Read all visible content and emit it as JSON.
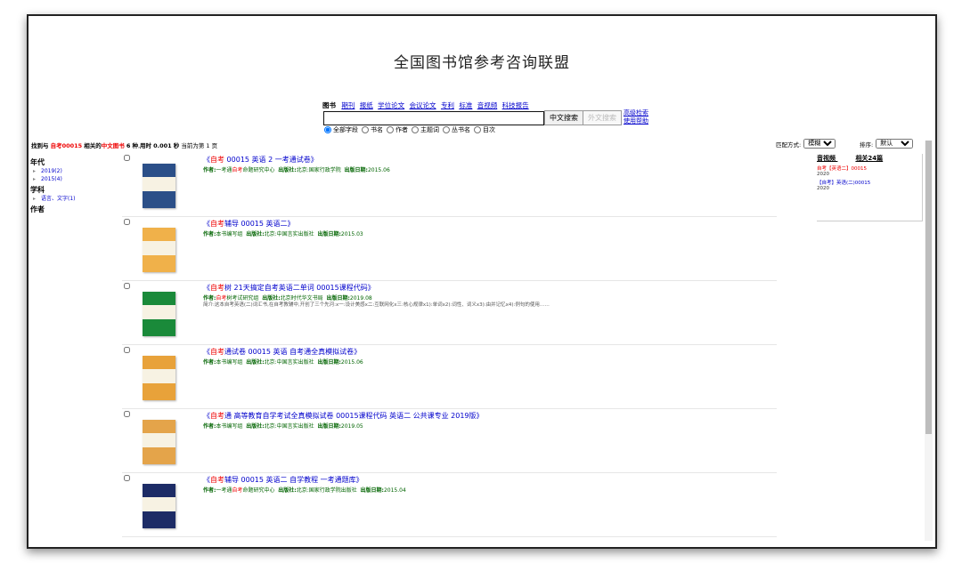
{
  "site": {
    "title": "全国图书馆参考咨询联盟"
  },
  "nav": {
    "current": "图书",
    "links": [
      "期刊",
      "报纸",
      "学位论文",
      "会议论文",
      "专利",
      "标准",
      "音视频",
      "科技报告"
    ]
  },
  "search": {
    "value": "",
    "cn_button": "中文搜索",
    "en_button": "外文搜索",
    "advanced": "高级检索",
    "help": "使用帮助",
    "fields": [
      "全部字段",
      "书名",
      "作者",
      "主题词",
      "丛书名",
      "目次"
    ],
    "selected_field": "全部字段"
  },
  "status": {
    "found_prefix": "找到与",
    "query": "自考00015",
    "related": "相关的",
    "collection": "中文图书",
    "count": "6",
    "unit": "种",
    "time_label": "用时",
    "time_value": "0.001",
    "time_unit": "秒",
    "page_text": "当前为第 1 页"
  },
  "match": {
    "label": "匹配方式:",
    "value": "模糊"
  },
  "sort": {
    "label": "排序:",
    "value": "默认"
  },
  "facets": {
    "year_title": "年代",
    "years": [
      "2019(2)",
      "2015(4)"
    ],
    "subject_title": "学科",
    "subjects": [
      "语言、文字(1)"
    ],
    "author_title": "作者"
  },
  "results": [
    {
      "title_parts": [
        "《",
        "自考",
        " 00015 英语 2 一考通试卷",
        "》"
      ],
      "author_prefix": "一考通",
      "author_hl": "自考",
      "author_suffix": "命题研究中心",
      "publisher": "北京:国家行政学院",
      "date": "2015.06",
      "snippet": ""
    },
    {
      "title_parts": [
        "《",
        "自考",
        "辅导 00015 英语二",
        "》"
      ],
      "author_prefix": "本书编写组",
      "author_hl": "",
      "author_suffix": "",
      "publisher": "北京:中国言实出版社",
      "date": "2015.03",
      "snippet": ""
    },
    {
      "title_parts": [
        "《",
        "自考",
        "树 21天搞定自考英语二单词 00015课程代码",
        "》"
      ],
      "author_prefix": "",
      "author_hl": "自考",
      "author_suffix": "树考试研究组",
      "publisher": "北京时代华文书局",
      "date": "2019.08",
      "snippet": "简介:这本自考英语(二)词汇书,在自考教辅中,开创了三个先河:x一:设计美感x二:互联网化x三:核心规律x1):单词x2):词性、词义x3):由并记忆x4):例句的使用……"
    },
    {
      "title_parts": [
        "《",
        "自考",
        "通试卷 00015 英语 自考通全真模拟试卷",
        "》"
      ],
      "author_prefix": "本书编写组",
      "author_hl": "",
      "author_suffix": "",
      "publisher": "北京:中国言实出版社",
      "date": "2015.06",
      "snippet": ""
    },
    {
      "title_parts": [
        "《",
        "自考",
        "通 高等教育自学考试全真模拟试卷 00015课程代码 英语二 公共课专业 2019版",
        "》"
      ],
      "author_prefix": "本书编写组",
      "author_hl": "",
      "author_suffix": "",
      "publisher": "北京:中国言实出版社",
      "date": "2019.05",
      "snippet": ""
    },
    {
      "title_parts": [
        "《",
        "自考",
        "辅导 00015 英语二 自学教程 一考通题库",
        "》"
      ],
      "author_prefix": "一考通",
      "author_hl": "自考",
      "author_suffix": "命题研究中心",
      "publisher": "北京:国家行政学院出版社",
      "date": "2015.04",
      "snippet": ""
    }
  ],
  "meta_labels": {
    "author": "作者:",
    "publisher": "出版社:",
    "date": "出版日期:"
  },
  "sidebox": {
    "title": "音视频",
    "related": "相关24篇",
    "items": [
      {
        "text": "自考【英语二】00015",
        "year": "2020"
      },
      {
        "text": "【自考】英语(二)00015",
        "year": "2020"
      }
    ]
  },
  "colors": {
    "link": "#0000cc",
    "highlight": "#ee0000",
    "meta": "#006400"
  },
  "covers": [
    "#2b4f88",
    "#f0b14a",
    "#1a8a3a",
    "#e8a23a",
    "#e4a44a",
    "#1d2c66"
  ]
}
